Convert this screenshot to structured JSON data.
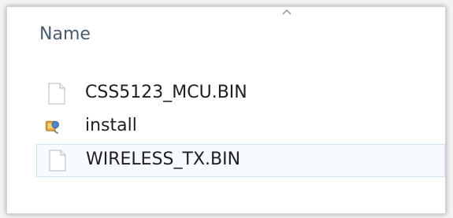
{
  "file_list": {
    "columns": {
      "name_header": "Name"
    },
    "sort_direction": "ascending",
    "items": [
      {
        "name": "CSS5123_MCU.BIN",
        "icon": "blank-file-icon",
        "selected": false
      },
      {
        "name": "install",
        "icon": "installer-icon",
        "selected": false
      },
      {
        "name": "WIRELESS_TX.BIN",
        "icon": "blank-file-icon",
        "selected": true
      }
    ]
  },
  "colors": {
    "header_text": "#4a5b6e",
    "selection_bg": "#f7fbff",
    "selection_border": "#cfe3f5"
  }
}
